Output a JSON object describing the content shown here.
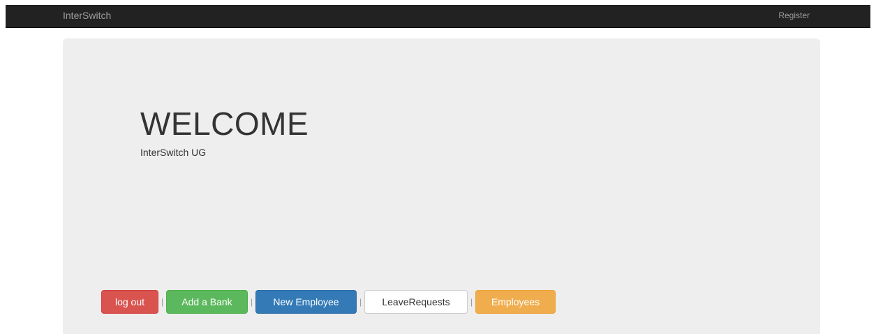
{
  "navbar": {
    "brand": "InterSwitch",
    "register_label": "Register"
  },
  "jumbotron": {
    "title": "WELCOME",
    "subtitle": "InterSwitch UG"
  },
  "actions": {
    "logout_label": "log out",
    "add_bank_label": "Add a Bank",
    "new_employee_label": "New Employee",
    "leave_requests_label": "LeaveRequests",
    "employees_label": "Employees",
    "separator": "|"
  },
  "colors": {
    "navbar_bg": "#222222",
    "jumbotron_bg": "#eeeeee",
    "danger": "#d9534f",
    "success": "#5cb85c",
    "primary": "#337ab7",
    "default": "#ffffff",
    "warning": "#f0ad4e"
  }
}
